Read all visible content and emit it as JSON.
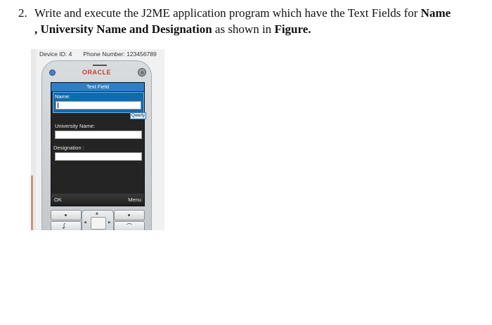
{
  "question": {
    "number": "2.",
    "text_1": "Write and execute the J2ME application program which have the Text Fields for ",
    "bold_1": "Name",
    "text_2": ", ",
    "bold_2": "University Name and Designation",
    "text_3": "  as shown in ",
    "bold_3": "Figure."
  },
  "emulator": {
    "device_id": "Device ID: 4",
    "phone_number": "Phone Number: 123456789",
    "brand": "ORACLE",
    "screen_title": "Text Field",
    "fields": [
      {
        "label": "Name:"
      },
      {
        "label": "University Name:"
      },
      {
        "label": "Designation :"
      }
    ],
    "input_mode": "Qwerty",
    "soft_left": "OK",
    "soft_right": "Menu"
  },
  "colors": {
    "title_bar": "#2c7fc5",
    "brand": "#d43a2b",
    "screen_bg": "#242424"
  }
}
